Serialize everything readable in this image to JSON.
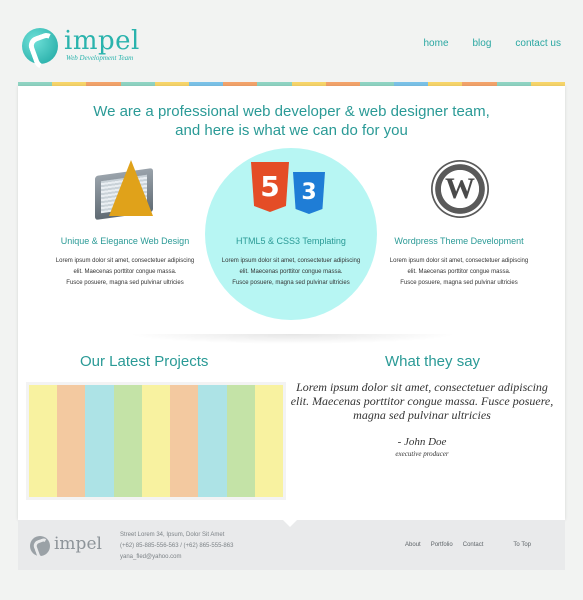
{
  "header": {
    "logo_name": "impel",
    "logo_sub": "Web Development Team",
    "nav": [
      {
        "label": "home"
      },
      {
        "label": "blog"
      },
      {
        "label": "contact us"
      }
    ]
  },
  "strip_colors": [
    "#8fd4c3",
    "#f7d56a",
    "#f3a36b",
    "#8fd4c3",
    "#f7d56a",
    "#7bc2e8",
    "#f3a36b",
    "#8fd4c3",
    "#f7d56a",
    "#f3a36b",
    "#8fd4c3",
    "#7bc2e8",
    "#f7d56a",
    "#f3a36b",
    "#8fd4c3",
    "#f7d56a"
  ],
  "intro": {
    "line1": "We are a professional web developer & web designer team,",
    "line2": "and here is what we can do for you"
  },
  "features": [
    {
      "icon": "design-tools-icon",
      "title": "Unique & Elegance Web Design",
      "lines": [
        "Lorem ipsum dolor sit amet, consectetuer adipiscing",
        "elit. Maecenas porttitor congue massa.",
        "Fusce posuere, magna sed pulvinar ultricies"
      ]
    },
    {
      "icon": "html5-css3-icon",
      "title": "HTML5 & CSS3  Templating",
      "lines": [
        "Lorem ipsum dolor sit amet, consectetuer adipiscing",
        "elit. Maecenas porttitor congue massa.",
        "Fusce posuere, magna sed pulvinar ultricies"
      ]
    },
    {
      "icon": "wordpress-icon",
      "title": "Wordpress Theme  Development",
      "lines": [
        "Lorem ipsum dolor sit amet, consectetuer adipiscing",
        "elit. Maecenas porttitor congue massa.",
        "Fusce posuere, magna sed pulvinar ultricies"
      ]
    }
  ],
  "html_badge": "5",
  "css_badge": "3",
  "wp_badge": "W",
  "projects": {
    "title": "Our Latest Projects",
    "stripe_colors": [
      "#f8f2a0",
      "#f3c9a0",
      "#ade3e6",
      "#c4e3a7",
      "#f8f2a0",
      "#f3c9a0",
      "#ade3e6",
      "#c4e3a7",
      "#f8f2a0"
    ]
  },
  "testimonial": {
    "title": "What they say",
    "quote": "Lorem ipsum dolor sit amet, consectetuer adipiscing elit. Maecenas porttitor congue massa. Fusce posuere, magna sed pulvinar ultricies",
    "author": "- John Doe",
    "role": "executive producer"
  },
  "footer": {
    "logo_name": "impel",
    "address": "Street Lorem 34, Ipsum, Dolor Sit Amet",
    "phones": "(+62) 85-885-556-563 /  (+62) 865-555-863",
    "email": "yana_fled@yahoo.com",
    "links": [
      "About",
      "Portfolio",
      "Contact"
    ],
    "to_top": "To Top"
  }
}
